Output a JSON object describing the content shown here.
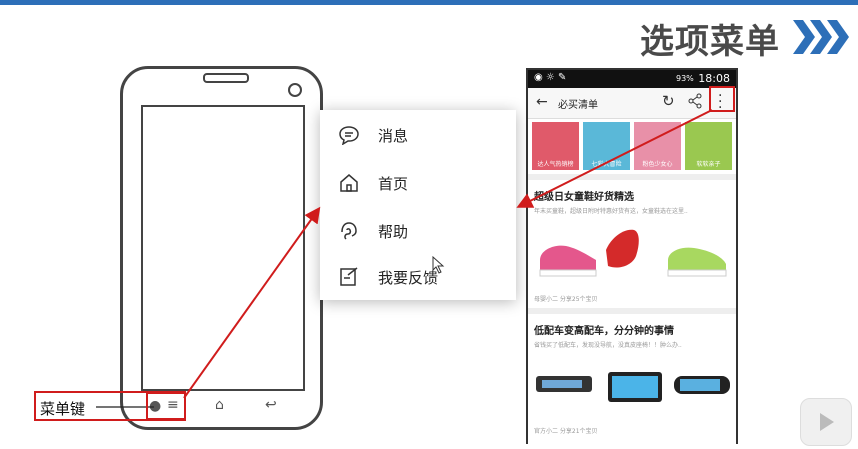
{
  "slide": {
    "title": "选项菜单",
    "menu_key_label": "菜单键",
    "accent_color": "#d01c1c",
    "title_color": "#4a4a4a",
    "chevron_color": "#2d6fb8"
  },
  "options_menu": {
    "items": [
      {
        "label": "消息",
        "icon": "message-bubble-icon"
      },
      {
        "label": "首页",
        "icon": "home-icon"
      },
      {
        "label": "帮助",
        "icon": "help-headset-icon"
      },
      {
        "label": "我要反馈",
        "icon": "feedback-edit-icon"
      }
    ]
  },
  "phone_screenshot": {
    "status_bar": {
      "time": "18:08",
      "battery": "93%"
    },
    "app_bar": {
      "title": "必买清单",
      "back_icon": "back-arrow-icon",
      "refresh_icon": "refresh-icon",
      "share_icon": "share-icon",
      "more_icon": "more-vertical-icon"
    },
    "thumbnails": [
      {
        "caption": "达人气热销榜",
        "color": "#e05a6a"
      },
      {
        "caption": "七彩大冒险",
        "color": "#5ab8d8"
      },
      {
        "caption": "粉色少女心",
        "color": "#e890a8"
      },
      {
        "caption": "软软亲子",
        "color": "#9ac850"
      }
    ],
    "section1": {
      "title": "超级日女童鞋好货精选",
      "subtitle": "年末买童鞋，超级日附时特惠好货有这，女童鞋选在这里..",
      "footer": "母婴小二 分享25个宝贝"
    },
    "section2": {
      "title": "低配车变高配车，分分钟的事情",
      "subtitle": "省钱买了低配车，发现没导航，没真皮座椅！！肿么办..",
      "footer": "官方小二 分享21个宝贝"
    }
  }
}
